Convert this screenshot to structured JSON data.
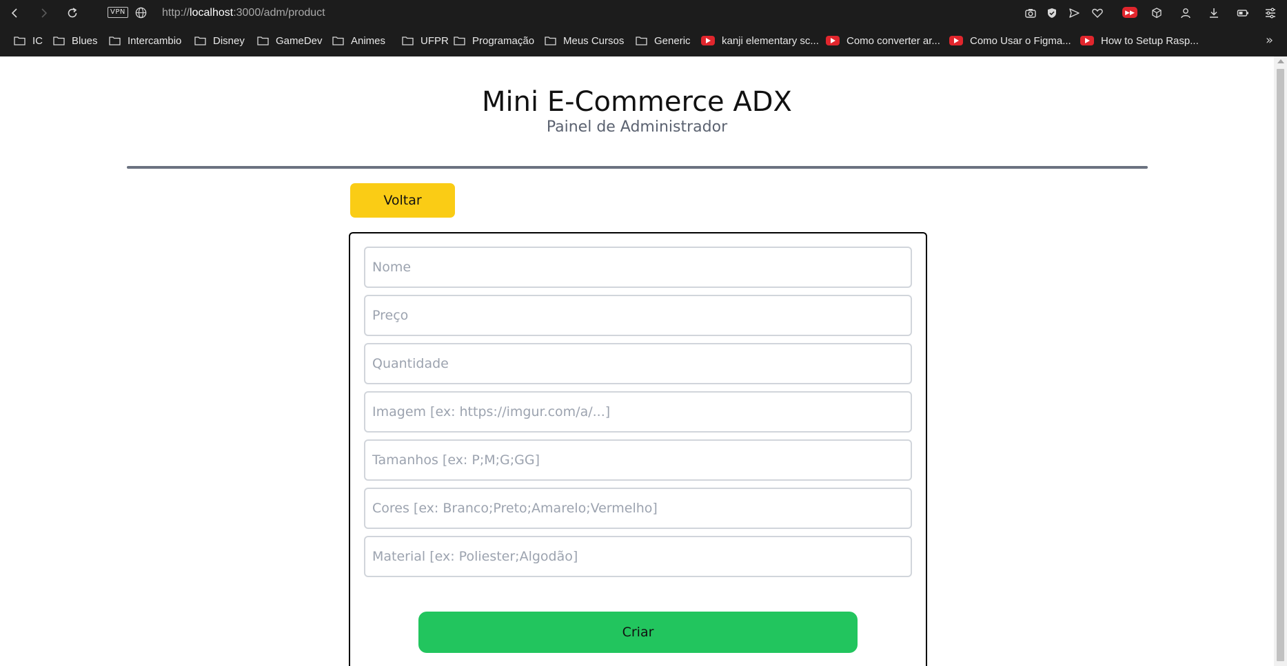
{
  "browser": {
    "url_prefix": "http://",
    "url_host": "localhost",
    "url_path": ":3000/adm/product",
    "vpn_label": "VPN",
    "bookmarks": [
      {
        "label": "IC",
        "icon": "folder-icon"
      },
      {
        "label": "Blues",
        "icon": "folder-icon"
      },
      {
        "label": "Intercambio",
        "icon": "folder-icon"
      },
      {
        "label": "Disney",
        "icon": "folder-icon"
      },
      {
        "label": "GameDev",
        "icon": "folder-icon"
      },
      {
        "label": "Animes",
        "icon": "folder-icon"
      },
      {
        "label": "UFPR",
        "icon": "folder-icon"
      },
      {
        "label": "Programação",
        "icon": "folder-icon"
      },
      {
        "label": "Meus Cursos",
        "icon": "folder-icon"
      },
      {
        "label": "Generic",
        "icon": "folder-icon"
      },
      {
        "label": "kanji elementary sc...",
        "icon": "youtube-icon"
      },
      {
        "label": "Como converter ar...",
        "icon": "youtube-icon"
      },
      {
        "label": "Como Usar o Figma...",
        "icon": "youtube-icon"
      },
      {
        "label": "How to Setup Rasp...",
        "icon": "youtube-icon"
      }
    ],
    "more_label": "»"
  },
  "page": {
    "title": "Mini E-Commerce ADX",
    "subtitle": "Painel de Administrador",
    "back_label": "Voltar",
    "submit_label": "Criar",
    "fields": {
      "name_placeholder": "Nome",
      "price_placeholder": "Preço",
      "quantity_placeholder": "Quantidade",
      "image_placeholder": "Imagem [ex: https://imgur.com/a/...]",
      "sizes_placeholder": "Tamanhos [ex: P;M;G;GG]",
      "colors_placeholder": "Cores [ex: Branco;Preto;Amarelo;Vermelho]",
      "material_placeholder": "Material [ex: Poliester;Algodão]"
    }
  },
  "colors": {
    "back_button": "#facc15",
    "submit_button": "#22c55e",
    "divider": "#6b7280",
    "chrome_bg": "#1c1c1c"
  }
}
